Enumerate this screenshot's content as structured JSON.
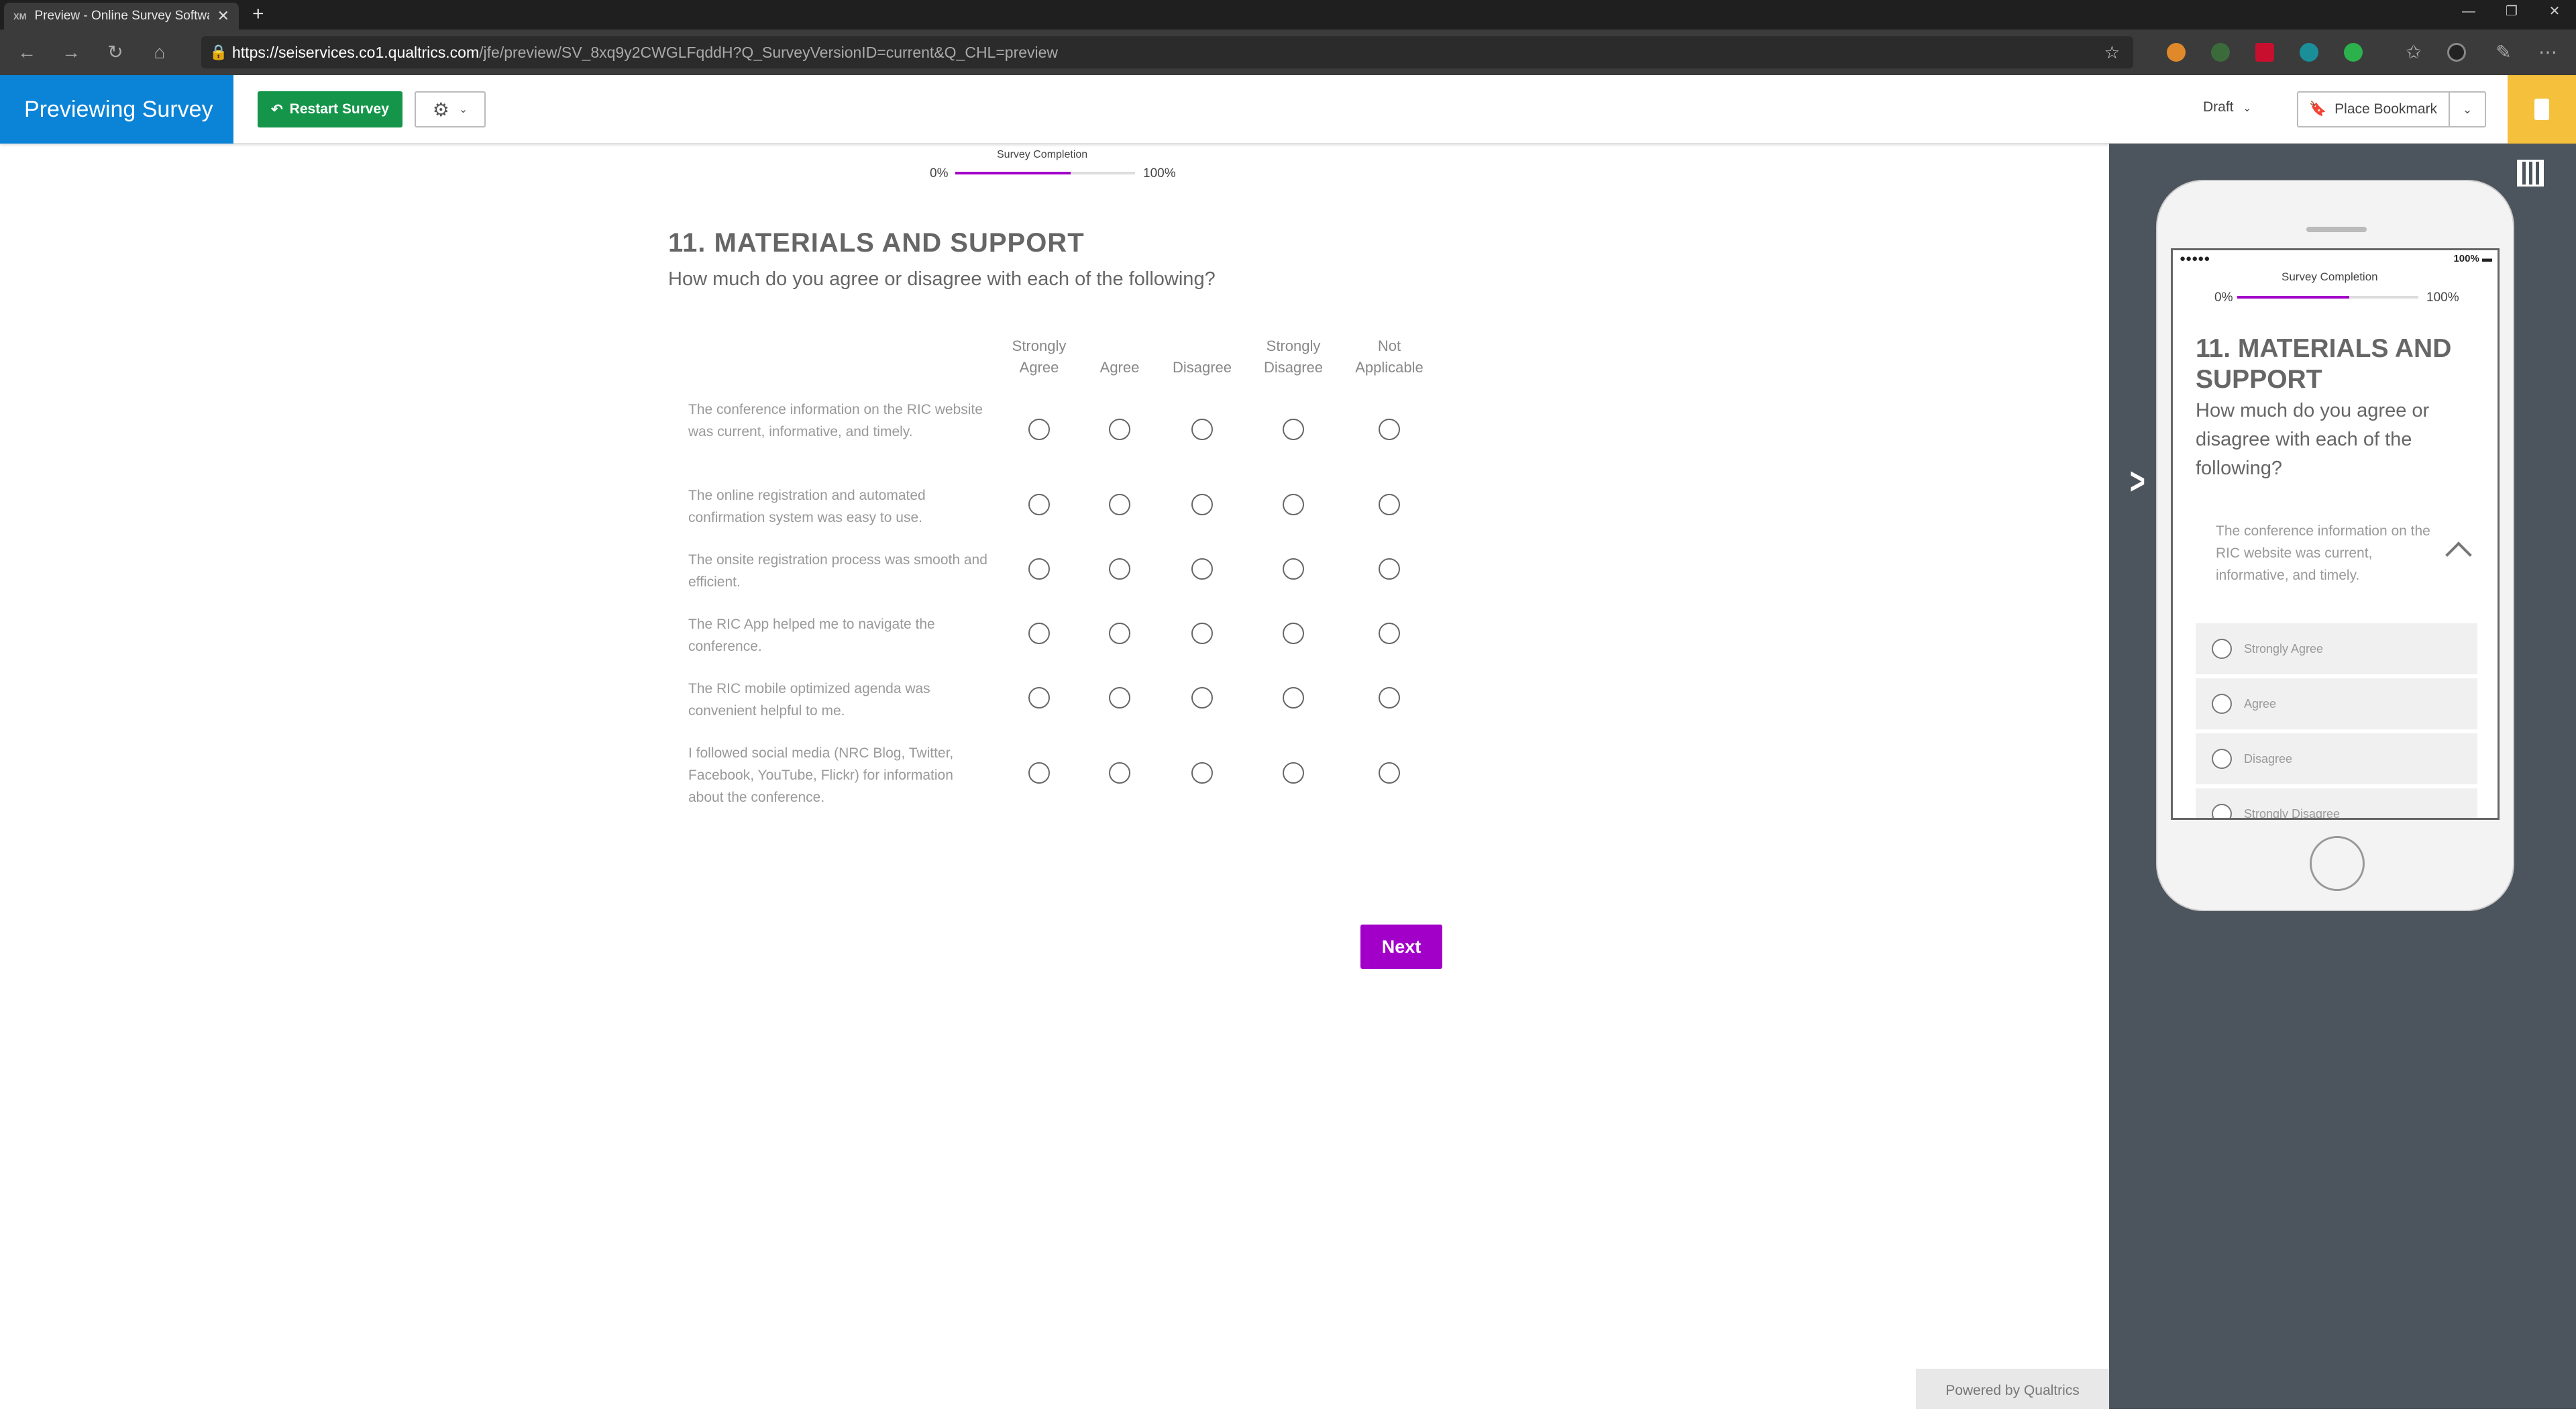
{
  "browser": {
    "tab_title": "Preview - Online Survey Software",
    "url_host": "https://seiservices.co1.qualtrics.com",
    "url_rest": "/jfe/preview/SV_8xq9y2CWGLFqddH?Q_SurveyVersionID=current&Q_CHL=preview"
  },
  "header": {
    "brand": "Previewing Survey",
    "restart_label": "Restart Survey",
    "draft_label": "Draft",
    "bookmark_label": "Place Bookmark"
  },
  "progress": {
    "label": "Survey Completion",
    "min_label": "0%",
    "max_label": "100%",
    "value": 0.64
  },
  "question": {
    "title": "11.  MATERIALS AND SUPPORT",
    "text": "How much do you agree or disagree with each of the following?",
    "columns": [
      [
        "Strongly",
        "Agree"
      ],
      [
        "",
        "Agree"
      ],
      [
        "",
        "Disagree"
      ],
      [
        "Strongly",
        "Disagree"
      ],
      [
        "Not",
        "Applicable"
      ]
    ],
    "rows": [
      "The conference information on the RIC website was current, informative, and timely.",
      "The online registration and automated confirmation system was easy to use.",
      "The onsite registration process was smooth and efficient.",
      "The RIC App helped me to navigate the conference.",
      "The RIC mobile optimized agenda was convenient helpful to me.",
      "I followed social media (NRC Blog, Twitter, Facebook, YouTube, Flickr) for information about the conference."
    ]
  },
  "next_label": "Next",
  "powered_by": "Powered by Qualtrics",
  "mobile": {
    "signal": "●●●●● ",
    "battery": "100%",
    "progress_label": "Survey Completion",
    "p0": "0%",
    "p100": "100%",
    "progress_value": 0.62,
    "title": "11.  MATERIALS AND SUPPORT",
    "text": "How much do you agree or disagree with each of the following?",
    "statement": "The conference information on the RIC website was current, informative, and timely.",
    "options": [
      "Strongly Agree",
      "Agree",
      "Disagree",
      "Strongly Disagree"
    ]
  },
  "colors": {
    "brand_blue": "#0b83d6",
    "restart_green": "#14954a",
    "accent_purple": "#a200c8",
    "panel_gray": "#4c555e",
    "notes_yellow": "#f5c03b"
  }
}
